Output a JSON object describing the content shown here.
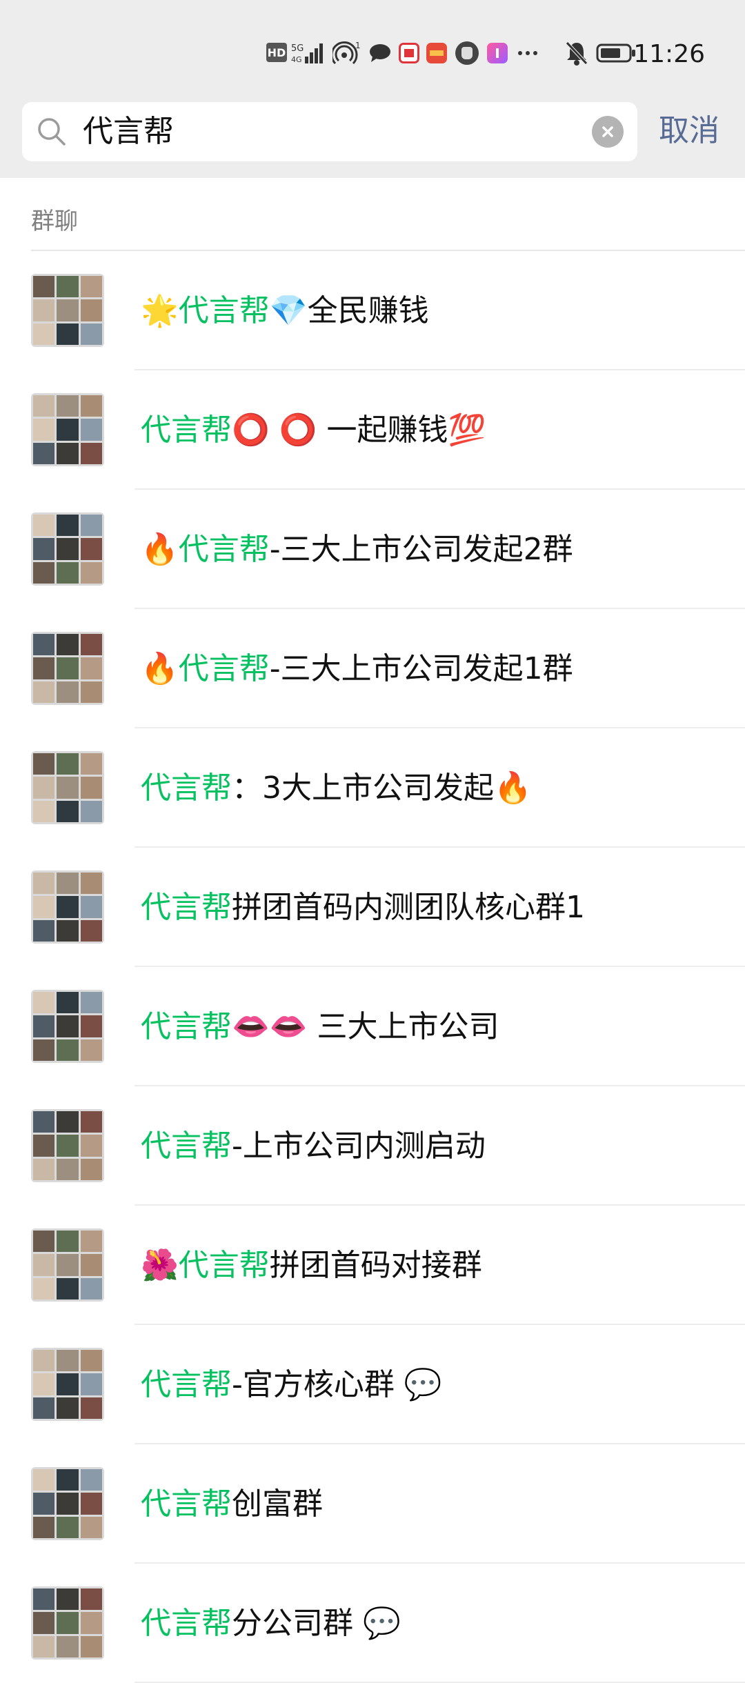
{
  "status_bar": {
    "time": "11:26",
    "icons": [
      "hd-icon",
      "signal-5g-icon",
      "hotspot-icon",
      "message-icon",
      "app-red-icon",
      "app-orange-icon",
      "app-hand-icon",
      "app-pink-icon",
      "more-dots-icon",
      "mute-bell-icon",
      "battery-icon"
    ]
  },
  "search": {
    "query": "代言帮",
    "cancel_label": "取消"
  },
  "section": {
    "title": "群聊"
  },
  "colors": {
    "highlight": "#07c160",
    "link": "#576b95",
    "background_top": "#ededed"
  },
  "results": [
    {
      "prefix": "🌟",
      "highlight": "代言帮",
      "rest": "💎全民赚钱",
      "tail": ""
    },
    {
      "prefix": "",
      "highlight": "代言帮",
      "rest": "⭕ ⭕ 一起赚钱💯",
      "tail": ""
    },
    {
      "prefix": "🔥",
      "highlight": "代言帮",
      "rest": "-三大上市公司发起2群",
      "tail": ""
    },
    {
      "prefix": "🔥",
      "highlight": "代言帮",
      "rest": "-三大上市公司发起1群",
      "tail": ""
    },
    {
      "prefix": "",
      "highlight": "代言帮",
      "rest": "：3大上市公司发起🔥",
      "tail": ""
    },
    {
      "prefix": "",
      "highlight": "代言帮",
      "rest": "拼团首码内测团队核心群1",
      "tail": ""
    },
    {
      "prefix": "",
      "highlight": "代言帮",
      "rest": " 👄👄 三大上市公司",
      "tail": ""
    },
    {
      "prefix": "",
      "highlight": "代言帮",
      "rest": "-上市公司内测启动",
      "tail": ""
    },
    {
      "prefix": "🌺 ",
      "highlight": "代言帮",
      "rest": "拼团首码对接群",
      "tail": ""
    },
    {
      "prefix": "",
      "highlight": "代言帮",
      "rest": "-官方核心群 💬",
      "tail": ""
    },
    {
      "prefix": "",
      "highlight": "代言帮",
      "rest": "创富群",
      "tail": ""
    },
    {
      "prefix": "",
      "highlight": "代言帮",
      "rest": "分公司群 💬",
      "tail": ""
    }
  ]
}
